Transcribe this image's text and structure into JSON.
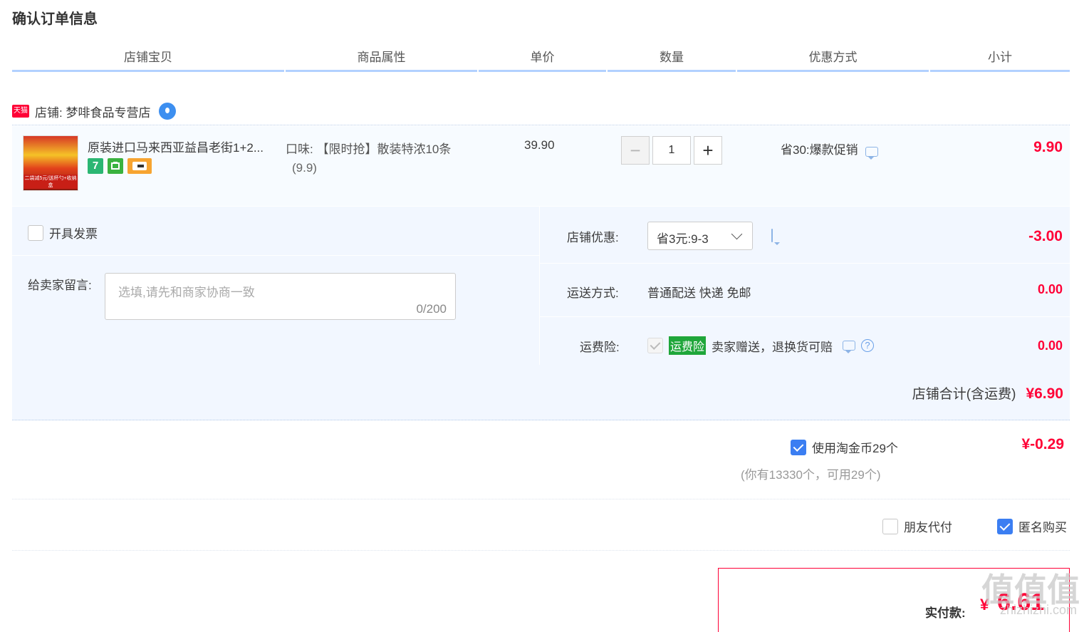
{
  "page": {
    "title": "确认订单信息"
  },
  "table_header": {
    "columns": [
      "店铺宝贝",
      "商品属性",
      "单价",
      "数量",
      "优惠方式",
      "小计"
    ]
  },
  "shop": {
    "badge": "天猫",
    "label": "店铺: 梦啡食品专营店"
  },
  "item": {
    "thumb_caption": "二袋减5元/送杯勺+收纳盒",
    "title": "原装进口马来西亚益昌老街1+2...",
    "service_icons": [
      {
        "name": "seven-day-return-icon",
        "text": "7",
        "color": "#2bb673"
      },
      {
        "name": "guarantee-icon",
        "text": "",
        "color": "#3ab23f"
      },
      {
        "name": "card-pay-icon",
        "text": "",
        "color": "#f7a431"
      }
    ],
    "attr_line1": "口味: 【限时抢】散装特浓10条",
    "attr_line2": "(9.9)",
    "unit_price": "39.90",
    "quantity": "1",
    "minus": "−",
    "plus": "+",
    "promo": "省30:爆款促销",
    "subtotal": "9.90"
  },
  "options": {
    "invoice_label": "开具发票",
    "memo_label": "给卖家留言:",
    "memo_placeholder": "选填,请先和商家协商一致",
    "memo_count": "0/200",
    "shop_discount_label": "店铺优惠:",
    "shop_discount_value": "省3元:9-3",
    "shop_discount_amount": "-3.00",
    "shipping_label": "运送方式:",
    "shipping_value": "普通配送 快递 免邮",
    "shipping_amount": "0.00",
    "insurance_label": "运费险:",
    "insurance_badge": "运费险",
    "insurance_text": "卖家赠送，退换货可赔",
    "insurance_help": "?",
    "insurance_amount": "0.00"
  },
  "shop_total": {
    "label": "店铺合计(含运费)",
    "amount": "¥6.90"
  },
  "coins": {
    "label": "使用淘金币29个",
    "note": "(你有13330个，可用29个)",
    "amount": "¥-0.29"
  },
  "extras": {
    "friend_pay_label": "朋友代付",
    "anonymous_label": "匿名购买"
  },
  "payment": {
    "label": "实付款:",
    "currency": "¥",
    "amount": "6.61"
  },
  "watermark": {
    "logo": "值值值",
    "site": "zhizhizhi.com"
  }
}
